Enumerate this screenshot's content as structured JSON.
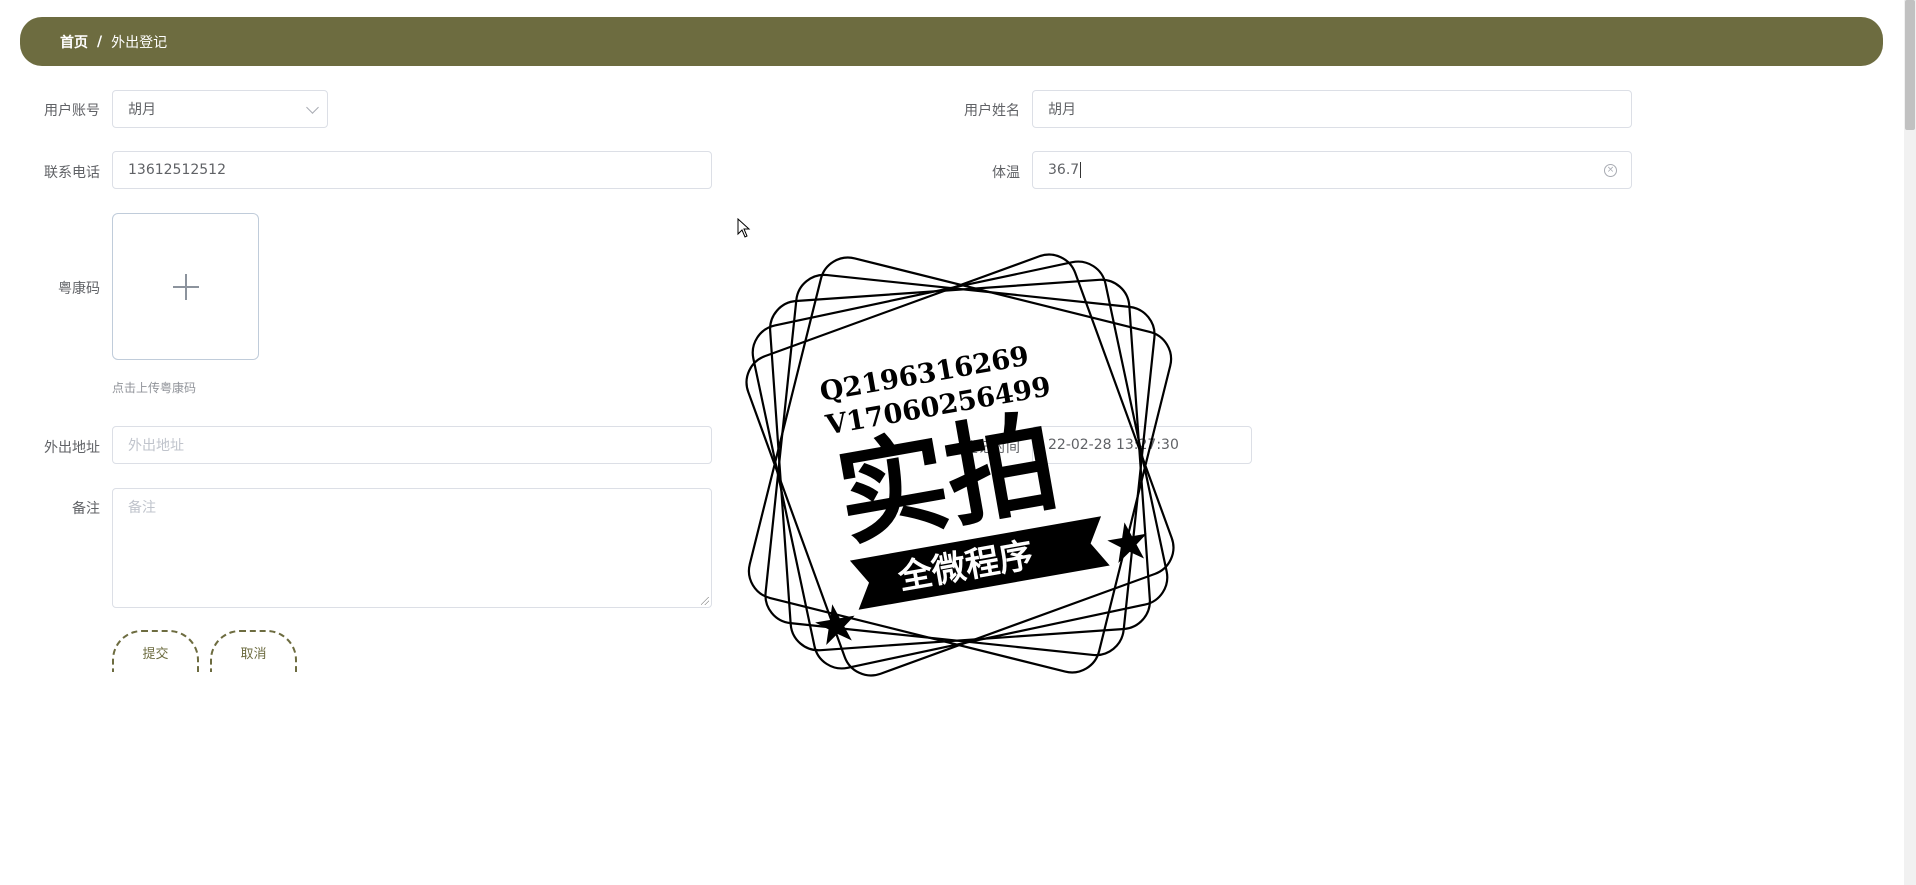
{
  "breadcrumb": {
    "home": "首页",
    "separator": "/",
    "current": "外出登记"
  },
  "form": {
    "account": {
      "label": "用户账号",
      "value": "胡月"
    },
    "name": {
      "label": "用户姓名",
      "value": "胡月"
    },
    "phone": {
      "label": "联系电话",
      "value": "13612512512"
    },
    "temperature": {
      "label": "体温",
      "value": "36.7"
    },
    "health_code": {
      "label": "粤康码",
      "hint": "点击上传粤康码"
    },
    "address": {
      "label": "外出地址",
      "placeholder": "外出地址"
    },
    "register_time": {
      "label": "登记时间",
      "value": "22-02-28 13:27:30"
    },
    "remark": {
      "label": "备注",
      "placeholder": "备注"
    }
  },
  "buttons": {
    "submit": "提交",
    "cancel": "取消"
  },
  "watermark": {
    "line1": "Q2196316269",
    "line2": "V17060256499",
    "main": "实拍",
    "banner": "全微程序"
  }
}
